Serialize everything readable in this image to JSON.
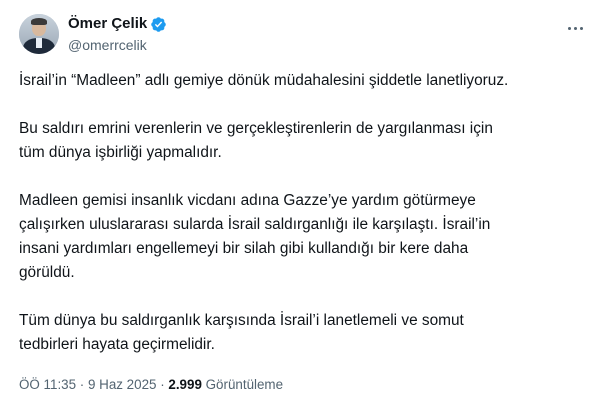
{
  "author": {
    "name": "Ömer Çelik",
    "handle": "@omerrcelik",
    "verified": true,
    "verified_color": "#1d9bf0"
  },
  "tweet": {
    "paragraphs": [
      "İsrail’in “Madleen” adlı gemiye dönük müdahalesini şiddetle lanetliyoruz.",
      "Bu saldırı emrini verenlerin ve gerçekleştirenlerin de yargılanması için\ntüm dünya işbirliği yapmalıdır.",
      "Madleen gemisi insanlık vicdanı adına Gazze’ye yardım götürmeye\nçalışırken uluslararası sularda İsrail saldırganlığı ile karşılaştı. İsrail’in\ninsani yardımları engellemeyi bir silah gibi kullandığı bir kere daha\ngörüldü.",
      "Tüm dünya bu saldırganlık karşısında İsrail’i lanetlemeli ve somut\ntedbirleri hayata geçirmelidir."
    ]
  },
  "meta": {
    "time": "ÖÖ 11:35",
    "separator": " · ",
    "date": "9 Haz 2025",
    "views_count": "2.999",
    "views_label": " Görüntüleme"
  },
  "icons": {
    "more": "more-horizontal-icon",
    "verified": "verified-badge-icon"
  }
}
